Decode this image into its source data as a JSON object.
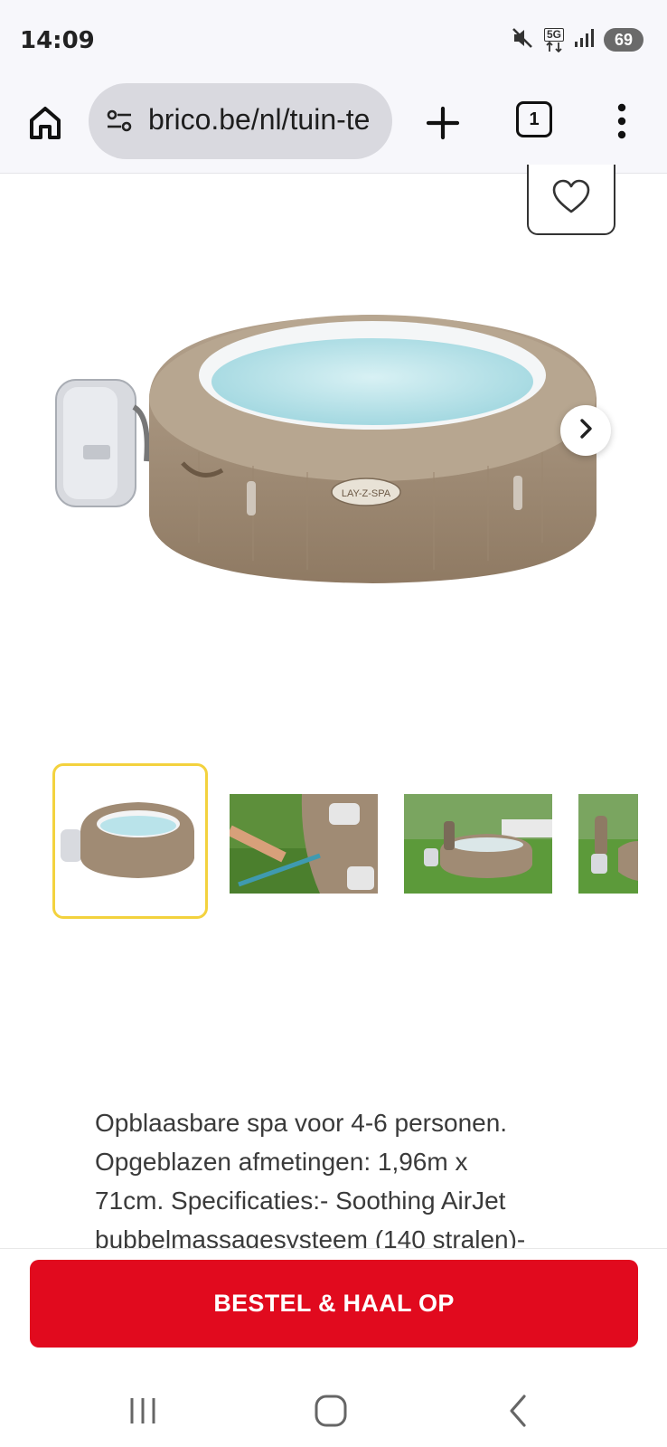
{
  "status_bar": {
    "time": "14:09",
    "network": "5G",
    "battery": "69",
    "icons": [
      "mute-icon",
      "5g-data-icon",
      "signal-icon",
      "battery-icon"
    ]
  },
  "browser": {
    "url": "brico.be/nl/tuin-te",
    "tab_count": "1",
    "icons": [
      "home-icon",
      "site-settings-icon",
      "plus-icon",
      "tabs-icon",
      "more-vert-icon"
    ]
  },
  "product": {
    "wishlist_icon": "heart-icon",
    "image_logo_text": "LAY-Z-SPA",
    "next_icon": "chevron-right-icon",
    "thumbnails": [
      "thumb-1",
      "thumb-2",
      "thumb-3",
      "thumb-4"
    ],
    "selected_thumbnail": 1,
    "description_lines": [
      "Opblaasbare spa voor 4-6 personen.",
      "Opgeblazen afmetingen: 1,96m x",
      "71cm. Specificaties:- Soothing AirJet",
      "bubbelmassagesysteem (140 stralen)-"
    ]
  },
  "cta": {
    "label": "BESTEL & HAAL OP"
  },
  "nav": {
    "icons": [
      "recent-apps-icon",
      "home-circle-icon",
      "back-icon"
    ]
  },
  "colors": {
    "accent": "#e10a1e",
    "thumb_selected": "#f3d23e",
    "spa_body": "#a08b74",
    "water": "#b9e3ea"
  }
}
